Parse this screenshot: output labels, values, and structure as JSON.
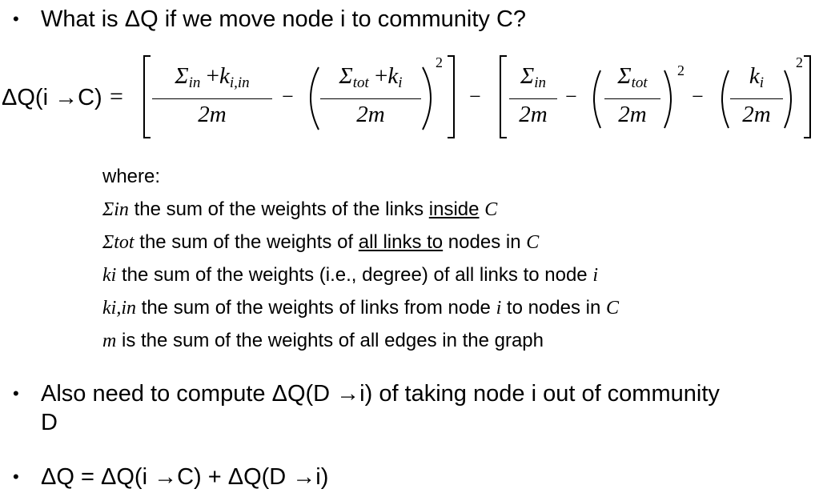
{
  "bullet1": {
    "bullet": "•",
    "text": "What is ΔQ if we move node i to community C?"
  },
  "formula": {
    "lhs": "ΔQ(i →C)",
    "equals": "=",
    "frac1_num_sigma": "Σ",
    "frac1_num_sub": "in",
    "frac1_num_plus": "+",
    "frac1_num_k": "k",
    "frac1_num_ksub": "i,in",
    "frac1_den": "2m",
    "frac2_num_sigma": "Σ",
    "frac2_num_sub": "tot",
    "frac2_num_plus": "+",
    "frac2_num_k": "k",
    "frac2_num_ksub": "i",
    "frac2_den": "2m",
    "frac3_num_sigma": "Σ",
    "frac3_num_sub": "in",
    "frac3_den": "2m",
    "frac4_num_sigma": "Σ",
    "frac4_num_sub": "tot",
    "frac4_den": "2m",
    "frac5_num_k": "k",
    "frac5_num_ksub": "i",
    "frac5_den": "2m",
    "minus": "−",
    "square": "2"
  },
  "definitions": {
    "where": "where:",
    "items": [
      {
        "symbol": "Σin",
        "pre": " the sum of the weights of the links ",
        "underlined": "inside",
        "post": " ",
        "tail_symbol": "C"
      },
      {
        "symbol": "Σtot",
        "pre": " the sum of the weights of ",
        "underlined": "all links to",
        "post": " nodes in ",
        "tail_symbol": "C"
      },
      {
        "symbol": "ki",
        "pre": " the sum of the weights (i.e., degree) of all links to node ",
        "underlined": "",
        "post": "",
        "tail_symbol": "i"
      },
      {
        "symbol": "ki,in",
        "pre": " the sum of the weights of links from node ",
        "mid_symbol": "i",
        "post": " to nodes in ",
        "tail_symbol": "C"
      },
      {
        "symbol": "m",
        "pre": " is the sum of the weights of all edges in the graph"
      }
    ]
  },
  "bullet2": {
    "bullet": "•",
    "line1": "Also need to compute ΔQ(D →i) of taking node i out of community",
    "line2": "D"
  },
  "bullet3": {
    "bullet": "•",
    "text": "ΔQ = ΔQ(i →C) + ΔQ(D →i)"
  }
}
